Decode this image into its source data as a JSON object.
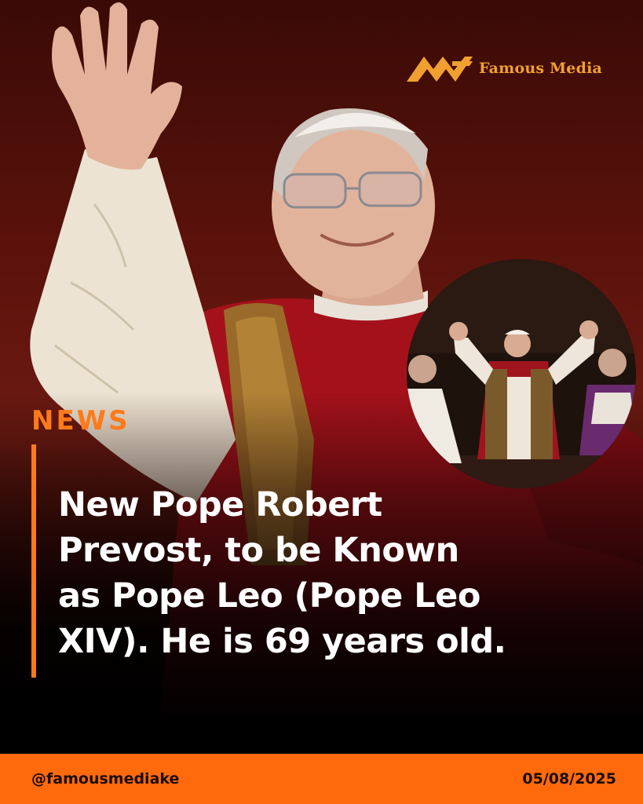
{
  "brand": {
    "name": "Famous Media",
    "accent": "#ff7a1a",
    "logo_color": "#f0a030"
  },
  "hero_image": {
    "subject": "smiling man in white skullcap and red-gold vestments waving"
  },
  "inset_image": {
    "subject": "pope waving on balcony with attendants"
  },
  "post": {
    "category": "NEWS",
    "headline": "  New Pope Robert\nPrevost, to be Known\nas Pope Leo (Pope Leo\nXIV). He is 69 years old."
  },
  "footer": {
    "handle": "@famousmediake",
    "date": "05/08/2025",
    "bg": "#ff6a0d"
  }
}
